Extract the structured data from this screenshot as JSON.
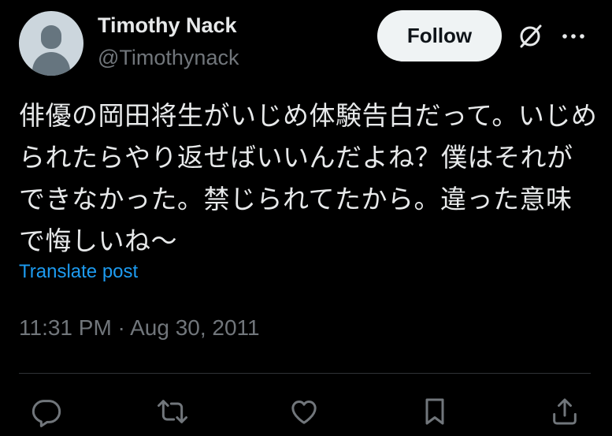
{
  "author": {
    "display_name": "Timothy Nack",
    "handle": "@Timothynack"
  },
  "follow_label": "Follow",
  "tweet": {
    "text": "俳優の岡田将生がいじめ体験告白だって。いじめられたらやり返せばいいんだよね？僕はそれができなかった。禁じられてたから。違った意味で悔しいね〜",
    "translate_label": "Translate post",
    "timestamp": "11:31 PM · Aug 30, 2011"
  },
  "actions": {
    "icons": [
      "reply-icon",
      "retweet-icon",
      "like-icon",
      "bookmark-icon",
      "share-icon"
    ]
  },
  "colors": {
    "background": "#000000",
    "text": "#e7e9ea",
    "secondary_text": "#71767b",
    "link": "#1d9bf0",
    "follow_button_bg": "#eff3f4"
  }
}
